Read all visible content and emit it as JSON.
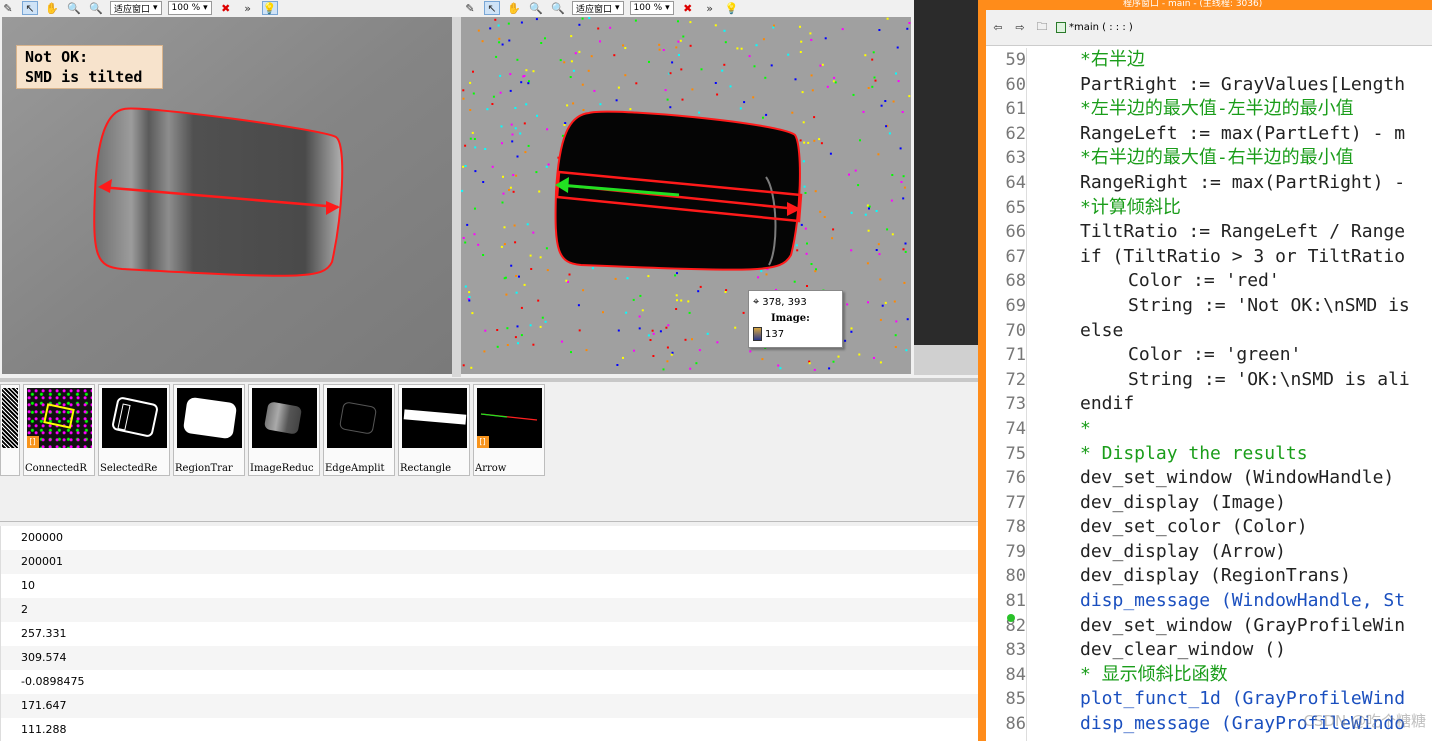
{
  "toolbar_left": {
    "window_mode": "适应窗口",
    "zoom": "100 %"
  },
  "toolbar_right": {
    "window_mode": "适应窗口",
    "zoom": "100 %"
  },
  "graphics_left": {
    "message_lines": "Not OK:\nSMD is tilted"
  },
  "graphics_right": {
    "pixel_info": {
      "coords": "378, 393",
      "label": "Image:",
      "value": "137"
    }
  },
  "thumbnails": [
    {
      "name": ""
    },
    {
      "name": "ConnectedR"
    },
    {
      "name": "SelectedRe"
    },
    {
      "name": "RegionTrar"
    },
    {
      "name": "ImageReduc"
    },
    {
      "name": "EdgeAmplit"
    },
    {
      "name": "Rectangle"
    },
    {
      "name": "Arrow"
    }
  ],
  "control_variables": [
    "200000",
    "200001",
    "10",
    "2",
    "257.331",
    "309.574",
    "-0.0898475",
    "171.647",
    "111.288"
  ],
  "editor": {
    "title_bar": "程序窗口 - main - (主线程: 3036)",
    "procedure": "*main ( : : : )",
    "lines": [
      {
        "n": "59",
        "text": "*右半边",
        "kind": "cmt"
      },
      {
        "n": "60",
        "text": "PartRight := GrayValues[Length",
        "kind": "code"
      },
      {
        "n": "61",
        "text": "*左半边的最大值-左半边的最小值",
        "kind": "cmt"
      },
      {
        "n": "62",
        "text": "RangeLeft := max(PartLeft) - m",
        "kind": "code"
      },
      {
        "n": "63",
        "text": "*右半边的最大值-右半边的最小值",
        "kind": "cmt"
      },
      {
        "n": "64",
        "text": "RangeRight := max(PartRight) -",
        "kind": "code"
      },
      {
        "n": "65",
        "text": "*计算倾斜比",
        "kind": "cmt"
      },
      {
        "n": "66",
        "text": "TiltRatio := RangeLeft / Range",
        "kind": "code"
      },
      {
        "n": "67",
        "text": "if (TiltRatio > 3 or TiltRatio",
        "kind": "code"
      },
      {
        "n": "68",
        "text": "Color := 'red'",
        "kind": "ind"
      },
      {
        "n": "69",
        "text": "String := 'Not OK:\\nSMD is",
        "kind": "ind"
      },
      {
        "n": "70",
        "text": "else",
        "kind": "code"
      },
      {
        "n": "71",
        "text": "Color := 'green'",
        "kind": "ind"
      },
      {
        "n": "72",
        "text": "String := 'OK:\\nSMD is ali",
        "kind": "ind"
      },
      {
        "n": "73",
        "text": "endif",
        "kind": "code"
      },
      {
        "n": "74",
        "text": "*",
        "kind": "cmt"
      },
      {
        "n": "75",
        "text": "* Display the results",
        "kind": "cmt"
      },
      {
        "n": "76",
        "text": "dev_set_window (WindowHandle)",
        "kind": "code"
      },
      {
        "n": "77",
        "text": "dev_display (Image)",
        "kind": "code"
      },
      {
        "n": "78",
        "text": "dev_set_color (Color)",
        "kind": "code"
      },
      {
        "n": "79",
        "text": "dev_display (Arrow)",
        "kind": "code"
      },
      {
        "n": "80",
        "text": "dev_display (RegionTrans)",
        "kind": "code"
      },
      {
        "n": "81",
        "text": "disp_message (WindowHandle, St",
        "kind": "op"
      },
      {
        "n": "82",
        "text": "dev_set_window (GrayProfileWin",
        "kind": "code"
      },
      {
        "n": "83",
        "text": "dev_clear_window ()",
        "kind": "code"
      },
      {
        "n": "84",
        "text": "* 显示倾斜比函数",
        "kind": "cmt"
      },
      {
        "n": "85",
        "text": "plot_funct_1d (GrayProfileWind",
        "kind": "op"
      },
      {
        "n": "86",
        "text": "disp_message (GrayProfileWindo",
        "kind": "op"
      }
    ],
    "watermark": "CSDN @吃个糖糖"
  }
}
